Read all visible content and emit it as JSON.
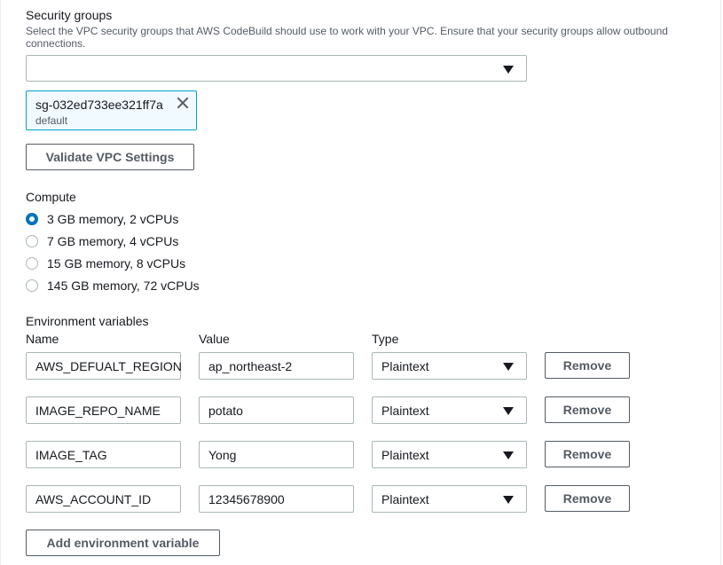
{
  "security_groups": {
    "label": "Security groups",
    "description_line1": "Select the VPC security groups that AWS CodeBuild should use to work with your VPC. Ensure that your security groups allow outbound",
    "description_line2": "connections.",
    "select_value": "",
    "selected_tokens": [
      {
        "id": "sg-032ed733ee321ff7a",
        "name": "default"
      }
    ]
  },
  "validate_button_label": "Validate VPC Settings",
  "compute": {
    "label": "Compute",
    "options": [
      {
        "label": "3 GB memory, 2 vCPUs",
        "checked": true
      },
      {
        "label": "7 GB memory, 4 vCPUs",
        "checked": false
      },
      {
        "label": "15 GB memory, 8 vCPUs",
        "checked": false
      },
      {
        "label": "145 GB memory, 72 vCPUs",
        "checked": false
      }
    ]
  },
  "env_vars": {
    "label": "Environment variables",
    "col_name": "Name",
    "col_value": "Value",
    "col_type": "Type",
    "remove_label": "Remove",
    "rows": [
      {
        "name": "AWS_DEFUALT_REGION",
        "value": "ap_northeast-2",
        "type": "Plaintext"
      },
      {
        "name": "IMAGE_REPO_NAME",
        "value": "potato",
        "type": "Plaintext"
      },
      {
        "name": "IMAGE_TAG",
        "value": "Yong",
        "type": "Plaintext"
      },
      {
        "name": "AWS_ACCOUNT_ID",
        "value": "12345678900",
        "type": "Plaintext"
      }
    ],
    "add_button_label": "Add environment variable"
  },
  "colors": {
    "accent": "#0073bb",
    "token_border": "#00a1c9",
    "token_bg": "#f1faff",
    "input_border": "#aab7b8",
    "button_text": "#545b64"
  }
}
